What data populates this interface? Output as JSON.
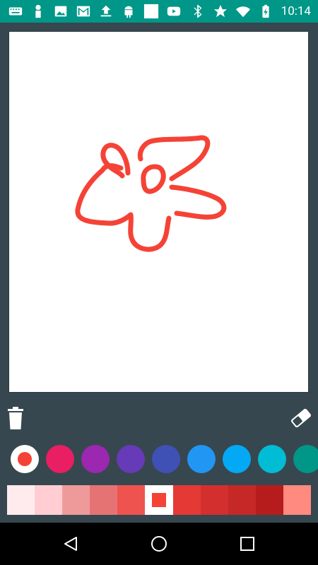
{
  "status_bar": {
    "time": "10:14",
    "left_icons": [
      "keyboard-icon",
      "person-icon",
      "image-icon",
      "gmail-icon",
      "upload-icon",
      "android-icon",
      "square-icon",
      "youtube-icon"
    ],
    "right_icons": [
      "bluetooth-icon",
      "star-icon",
      "wifi-icon",
      "battery-charging-icon"
    ]
  },
  "canvas": {
    "background": "#ffffff",
    "stroke_color": "#f44336"
  },
  "tools": {
    "trash": "trash-icon",
    "eraser": "eraser-icon"
  },
  "colors": {
    "palette": [
      "#f44336",
      "#e91e63",
      "#9c27b0",
      "#673ab7",
      "#3f51b5",
      "#2196f3",
      "#03a9f4",
      "#00bcd4",
      "#009688"
    ],
    "selected_index": 0
  },
  "shades": {
    "palette": [
      "#ffebee",
      "#ffcdd2",
      "#ef9a9a",
      "#e57373",
      "#ef5350",
      "#f44336",
      "#e53935",
      "#d32f2f",
      "#c62828",
      "#b71c1c",
      "#ff8a80"
    ],
    "selected_index": 5
  },
  "nav": {
    "back": "back-icon",
    "home": "home-icon",
    "recents": "recents-icon"
  }
}
